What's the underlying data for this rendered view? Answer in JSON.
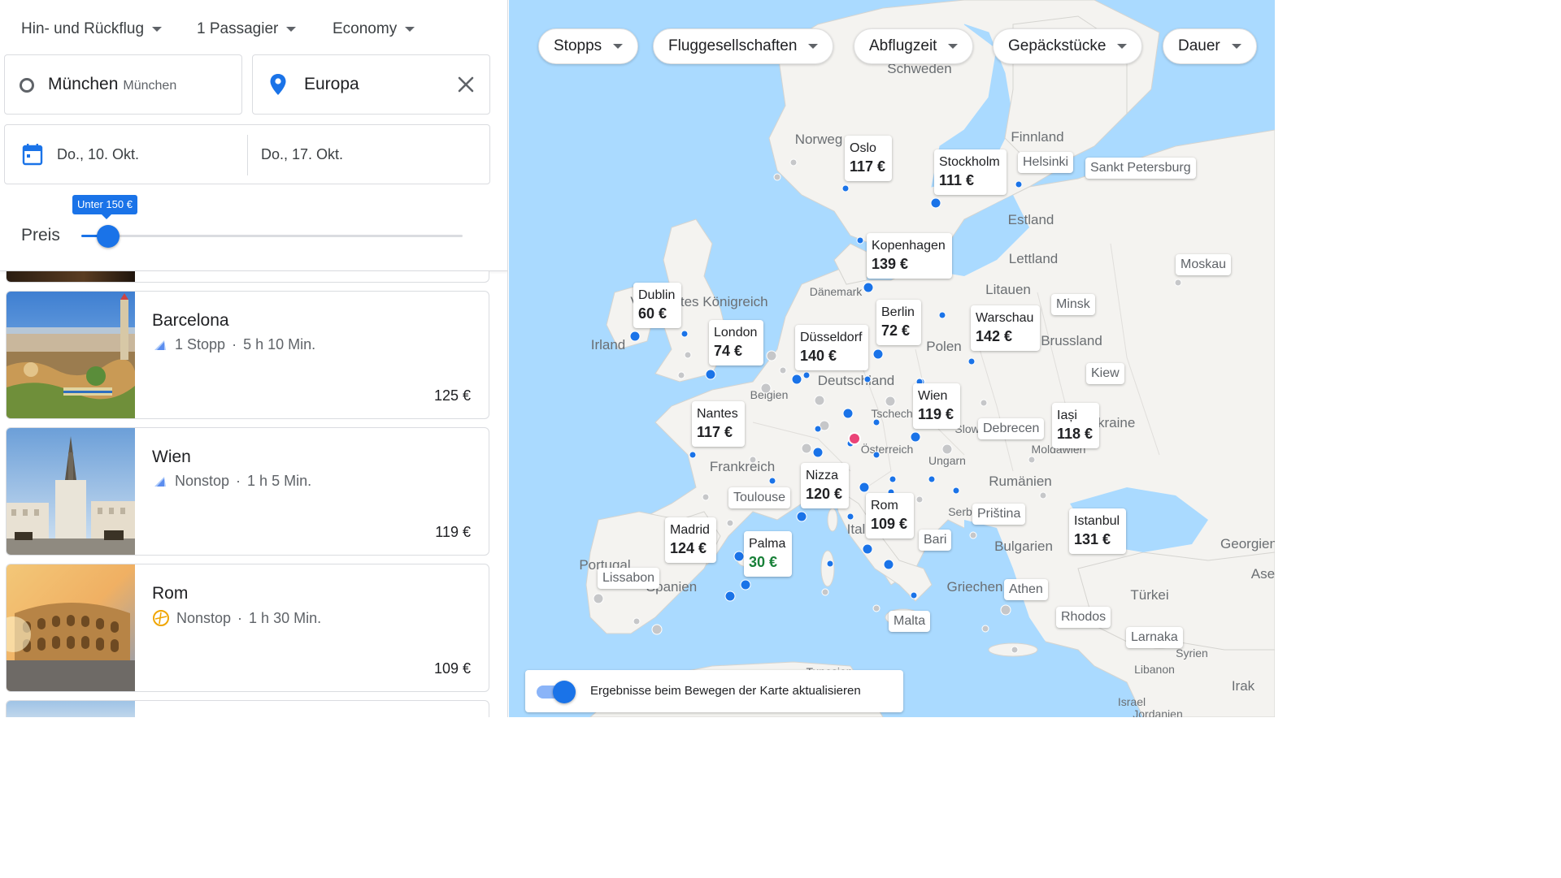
{
  "search": {
    "trip_type": "Hin- und Rückflug",
    "passengers": "1 Passagier",
    "cabin": "Economy",
    "origin": "München",
    "origin_sub": "München",
    "destination": "Europa",
    "depart_date": "Do., 10. Okt.",
    "return_date": "Do., 17. Okt."
  },
  "price_filter": {
    "label": "Preis",
    "tooltip": "Unter 150 €",
    "level": 0.07
  },
  "results": [
    {
      "city": "Barcelona",
      "stops": "1 Stopp",
      "duration": "5 h 10 Min.",
      "price": "125 €",
      "airline_icon": "airline-logo-icon"
    },
    {
      "city": "Wien",
      "stops": "Nonstop",
      "duration": "1 h 5 Min.",
      "price": "119 €",
      "airline_icon": "airline-logo-icon"
    },
    {
      "city": "Rom",
      "stops": "Nonstop",
      "duration": "1 h 30 Min.",
      "price": "109 €",
      "airline_icon": "lufthansa-logo-icon"
    }
  ],
  "filters": {
    "stops": "Stopps",
    "airlines": "Fluggesellschaften",
    "departure": "Abflugzeit",
    "baggage": "Gepäckstücke",
    "duration": "Dauer"
  },
  "map": {
    "update_label": "Ergebnisse beim Bewegen der Karte aktualisieren",
    "update_enabled": true,
    "price_cards": [
      {
        "city": "Oslo",
        "price": "117 €"
      },
      {
        "city": "Stockholm",
        "price": "111 €"
      },
      {
        "city": "Kopenhagen",
        "price": "139 €"
      },
      {
        "city": "Dublin",
        "price": "60 €"
      },
      {
        "city": "London",
        "price": "74 €"
      },
      {
        "city": "Düsseldorf",
        "price": "140 €"
      },
      {
        "city": "Berlin",
        "price": "72 €"
      },
      {
        "city": "Warschau",
        "price": "142 €"
      },
      {
        "city": "Wien",
        "price": "119 €"
      },
      {
        "city": "Iași",
        "price": "118 €"
      },
      {
        "city": "Nantes",
        "price": "117 €"
      },
      {
        "city": "Nizza",
        "price": "120 €"
      },
      {
        "city": "Rom",
        "price": "109 €"
      },
      {
        "city": "Madrid",
        "price": "124 €"
      },
      {
        "city": "Palma",
        "price": "30 €",
        "highlight": true
      },
      {
        "city": "Istanbul",
        "price": "131 €"
      }
    ],
    "name_cards": [
      "Helsinki",
      "Sankt Petersburg",
      "Moskau",
      "Minsk",
      "Kiew",
      "Debrecen",
      "Toulouse",
      "Priština",
      "Bari",
      "Lissabon",
      "Athen",
      "Malta",
      "Rhodos",
      "Larnaka"
    ],
    "country_labels": [
      "Schweden",
      "Norweg",
      "Finnland",
      "Estland",
      "Lettland",
      "Litauen",
      "Dänemark",
      "Vereinigtes Königreich",
      "Irland",
      "Polen",
      "Brussland",
      "Deutschland",
      "Belgien",
      "Tschech",
      "Slowak",
      "Ukraine",
      "Moldawien",
      "Österreich",
      "Ungarn",
      "Frankreich",
      "Rumänien",
      "Serb",
      "Ital",
      "Bulgarien",
      "Portugal",
      "Spanien",
      "Griechen",
      "Türkei",
      "Georgien",
      "Syrien",
      "Libanon",
      "Irak",
      "Israel",
      "Jordanien",
      "Tunesien",
      "Aserb"
    ]
  }
}
